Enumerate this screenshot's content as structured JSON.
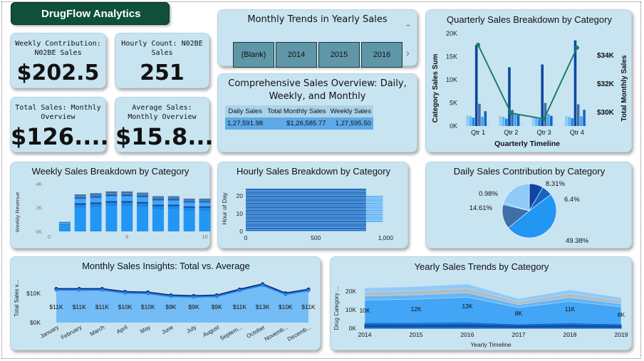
{
  "app": {
    "title": "DrugFlow Analytics"
  },
  "kpis": {
    "weekly": {
      "label": "Weekly Contribution: N02BE Sales",
      "value": "$202.5"
    },
    "hourly": {
      "label": "Hourly Count: N02BE Sales",
      "value": "251"
    },
    "total": {
      "label": "Total Sales: Monthly Overview",
      "value": "$126...."
    },
    "average": {
      "label": "Average Sales: Monthly Overview",
      "value": "$15.8..."
    }
  },
  "trends": {
    "title": "Monthly Trends in Yearly Sales",
    "slicers": [
      "(Blank)",
      "2014",
      "2015",
      "2016"
    ]
  },
  "overview": {
    "title": "Comprehensive Sales Overview: Daily, Weekly, and Monthly",
    "headers": [
      "Daily Sales",
      "Total Monthly Sales",
      "Weekly Sales"
    ],
    "row": [
      "1,27,591.98",
      "$1,26,585.77",
      "1,27,595.50"
    ]
  },
  "quarterly": {
    "title": "Quarterly Sales Breakdown by Category",
    "chart_data": {
      "type": "bar",
      "categories": [
        "Qtr 1",
        "Qtr 2",
        "Qtr 3",
        "Qtr 4"
      ],
      "series": [
        {
          "values": [
            2300,
            2100,
            1900,
            2200
          ]
        },
        {
          "values": [
            2100,
            2000,
            1800,
            2000
          ]
        },
        {
          "values": [
            1800,
            1600,
            1500,
            1700
          ]
        },
        {
          "values": [
            17500,
            12700,
            13300,
            18500
          ]
        },
        {
          "values": [
            4800,
            3500,
            5000,
            4700
          ]
        },
        {
          "values": [
            2000,
            2800,
            2600,
            2100
          ]
        },
        {
          "values": [
            3200,
            2400,
            2200,
            3500
          ]
        },
        {
          "values": [
            1000,
            700,
            700,
            900
          ]
        }
      ],
      "line": {
        "values": [
          34700,
          29900,
          29500,
          34500
        ]
      },
      "xlabel": "Quarterly Timeline",
      "ylabel": "Category Sales Sum",
      "y2label": "Total Monthly Sales",
      "yticks": [
        "0K",
        "5K",
        "10K",
        "15K",
        "20K"
      ],
      "y2ticks": [
        "$30K",
        "$32K",
        "$34K"
      ],
      "ylim": [
        0,
        20000
      ],
      "y2lim": [
        29000,
        35500
      ]
    }
  },
  "weekly_chart": {
    "title": "Weekly Sales Breakdown by Category",
    "chart_data": {
      "type": "bar",
      "stacked": true,
      "x": [
        1,
        2,
        3,
        4,
        5,
        6,
        7,
        8,
        9,
        10
      ],
      "totals": [
        800,
        3100,
        3200,
        3350,
        3350,
        3250,
        2950,
        2950,
        2750,
        2750
      ],
      "xticks": [
        "0",
        "5",
        "10"
      ],
      "yticks": [
        "0K",
        "2K",
        "4K"
      ],
      "ylabel": "Weekly Revenue",
      "ylim": [
        0,
        4000
      ]
    }
  },
  "hourly_chart": {
    "title": "Hourly Sales Breakdown by Category",
    "chart_data": {
      "type": "bar",
      "orientation": "horizontal",
      "xticks": [
        "0",
        "500",
        "1,000"
      ],
      "yticks": [
        "0",
        "10",
        "20"
      ],
      "ylabel": "Hour of Day",
      "xlim": [
        0,
        1100
      ],
      "ylim": [
        0,
        24
      ]
    }
  },
  "daily": {
    "title": "Daily Sales Contribution by Category",
    "chart_data": {
      "type": "pie",
      "values": [
        8.31,
        6.4,
        49.38,
        14.61,
        0.98
      ],
      "labels": [
        "8.31%",
        "6.4%",
        "49.38%",
        "14.61%",
        "0.98%"
      ]
    }
  },
  "monthly": {
    "title": "Monthly Sales Insights: Total vs. Average",
    "chart_data": {
      "type": "line",
      "categories": [
        "January",
        "February",
        "March",
        "April",
        "May",
        "June",
        "July",
        "August",
        "Septem...",
        "October",
        "Novemb...",
        "Decemb..."
      ],
      "series": [
        {
          "values": [
            11500,
            11500,
            11500,
            10500,
            10300,
            9300,
            9100,
            9300,
            11300,
            13100,
            10000,
            11300
          ]
        },
        {
          "values": [
            11100,
            11100,
            11100,
            10100,
            9900,
            8900,
            8700,
            8900,
            10900,
            12700,
            9600,
            10900
          ]
        }
      ],
      "labels": [
        "$11K",
        "$11K",
        "$11K",
        "$10K",
        "$10K",
        "$9K",
        "$9K",
        "$9K",
        "$11K",
        "$13K",
        "$10K",
        "$11K"
      ],
      "ylabel": "Total Sales v...",
      "yticks": [
        "$0K",
        "$10K"
      ],
      "ylim": [
        0,
        16000
      ]
    }
  },
  "yearly": {
    "title": "Yearly Sales Trends by Category",
    "chart_data": {
      "type": "area",
      "categories": [
        "2014",
        "2015",
        "2016",
        "2017",
        "2018",
        "2019"
      ],
      "top_values": [
        21800,
        22500,
        24000,
        16000,
        20800,
        16500
      ],
      "labels": [
        "10K",
        "12K",
        "13K",
        "8K",
        "11K",
        "8K"
      ],
      "xlabel": "Yearly Timeline",
      "ylabel": "Drug Category ...",
      "yticks": [
        "0K",
        "10K",
        "20K"
      ],
      "ylim": [
        0,
        27000
      ]
    }
  },
  "colors": {
    "card": "#c8e4f1",
    "banner": "#0e5138",
    "accent": "#1e88e5",
    "dark": "#0d47a1",
    "line": "#1b7d6c"
  }
}
